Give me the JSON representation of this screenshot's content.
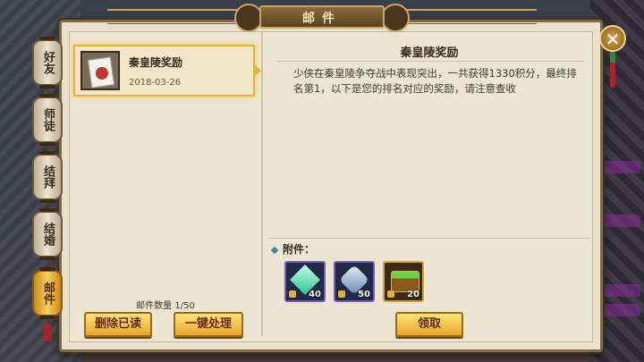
{
  "window": {
    "title": "邮件"
  },
  "side_tabs": [
    {
      "label": "好友",
      "active": false
    },
    {
      "label": "师徒",
      "active": false
    },
    {
      "label": "结拜",
      "active": false
    },
    {
      "label": "结婚",
      "active": false
    },
    {
      "label": "邮件",
      "active": true
    }
  ],
  "mail_list": {
    "items": [
      {
        "title": "秦皇陵奖励",
        "date": "2018-03-26",
        "selected": true
      }
    ],
    "count_label": "邮件数量 1/50"
  },
  "buttons": {
    "delete_read": "删除已读",
    "process_all": "一键处理",
    "claim": "领取",
    "close": "✕"
  },
  "detail": {
    "title": "秦皇陵奖励",
    "body": "少侠在秦皇陵争夺战中表现突出，一共获得1330积分，最终排名第1，以下是您的排名对应的奖励，请注意查收"
  },
  "attachments": {
    "label": "附件：",
    "items": [
      {
        "icon": "green-crystal-icon",
        "qty": "40",
        "color": "#3fd6a0"
      },
      {
        "icon": "silver-ore-icon",
        "qty": "50",
        "color": "#9fb4d6"
      },
      {
        "icon": "treasure-chest-icon",
        "qty": "20",
        "color": "#c98a2a"
      }
    ]
  }
}
